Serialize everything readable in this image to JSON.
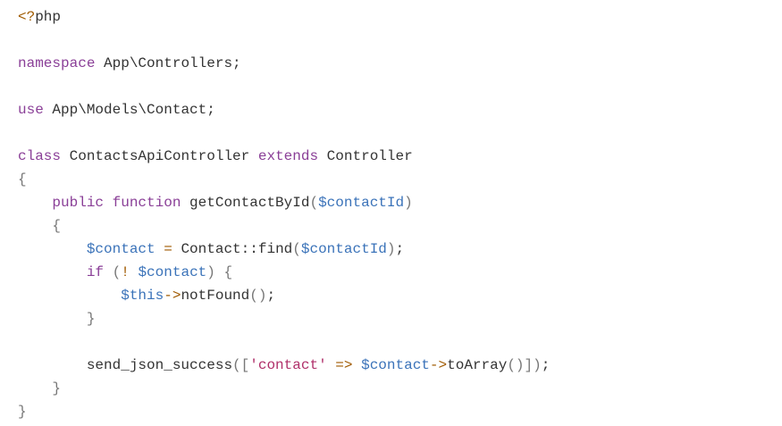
{
  "code": {
    "language": "php",
    "colors": {
      "default": "#333333",
      "keyword": "#8a3f97",
      "variable": "#3b73b9",
      "string": "#b0306a",
      "operator": "#a05a00",
      "punct": "#777777",
      "phptag": "#a05a00"
    },
    "lines": [
      [
        {
          "t": "phptag",
          "v": "<?"
        },
        {
          "t": "default",
          "v": "php"
        }
      ],
      [],
      [
        {
          "t": "keyword",
          "v": "namespace"
        },
        {
          "t": "default",
          "v": " App\\Controllers;"
        }
      ],
      [],
      [
        {
          "t": "keyword",
          "v": "use"
        },
        {
          "t": "default",
          "v": " App\\Models\\Contact;"
        }
      ],
      [],
      [
        {
          "t": "keyword",
          "v": "class"
        },
        {
          "t": "default",
          "v": " ContactsApiController "
        },
        {
          "t": "keyword",
          "v": "extends"
        },
        {
          "t": "default",
          "v": " Controller"
        }
      ],
      [
        {
          "t": "punct",
          "v": "{"
        }
      ],
      [
        {
          "t": "default",
          "v": "    "
        },
        {
          "t": "keyword",
          "v": "public"
        },
        {
          "t": "default",
          "v": " "
        },
        {
          "t": "keyword",
          "v": "function"
        },
        {
          "t": "default",
          "v": " getContactById"
        },
        {
          "t": "punct",
          "v": "("
        },
        {
          "t": "variable",
          "v": "$contactId"
        },
        {
          "t": "punct",
          "v": ")"
        }
      ],
      [
        {
          "t": "default",
          "v": "    "
        },
        {
          "t": "punct",
          "v": "{"
        }
      ],
      [
        {
          "t": "default",
          "v": "        "
        },
        {
          "t": "variable",
          "v": "$contact"
        },
        {
          "t": "default",
          "v": " "
        },
        {
          "t": "operator",
          "v": "="
        },
        {
          "t": "default",
          "v": " Contact::find"
        },
        {
          "t": "punct",
          "v": "("
        },
        {
          "t": "variable",
          "v": "$contactId"
        },
        {
          "t": "punct",
          "v": ")"
        },
        {
          "t": "default",
          "v": ";"
        }
      ],
      [
        {
          "t": "default",
          "v": "        "
        },
        {
          "t": "keyword",
          "v": "if"
        },
        {
          "t": "default",
          "v": " "
        },
        {
          "t": "punct",
          "v": "("
        },
        {
          "t": "operator",
          "v": "!"
        },
        {
          "t": "default",
          "v": " "
        },
        {
          "t": "variable",
          "v": "$contact"
        },
        {
          "t": "punct",
          "v": ")"
        },
        {
          "t": "default",
          "v": " "
        },
        {
          "t": "punct",
          "v": "{"
        }
      ],
      [
        {
          "t": "default",
          "v": "            "
        },
        {
          "t": "variable",
          "v": "$this"
        },
        {
          "t": "operator",
          "v": "->"
        },
        {
          "t": "default",
          "v": "notFound"
        },
        {
          "t": "punct",
          "v": "()"
        },
        {
          "t": "default",
          "v": ";"
        }
      ],
      [
        {
          "t": "default",
          "v": "        "
        },
        {
          "t": "punct",
          "v": "}"
        }
      ],
      [],
      [
        {
          "t": "default",
          "v": "        send_json_success"
        },
        {
          "t": "punct",
          "v": "(["
        },
        {
          "t": "string",
          "v": "'contact'"
        },
        {
          "t": "default",
          "v": " "
        },
        {
          "t": "operator",
          "v": "=>"
        },
        {
          "t": "default",
          "v": " "
        },
        {
          "t": "variable",
          "v": "$contact"
        },
        {
          "t": "operator",
          "v": "->"
        },
        {
          "t": "default",
          "v": "toArray"
        },
        {
          "t": "punct",
          "v": "()])"
        },
        {
          "t": "default",
          "v": ";"
        }
      ],
      [
        {
          "t": "default",
          "v": "    "
        },
        {
          "t": "punct",
          "v": "}"
        }
      ],
      [
        {
          "t": "punct",
          "v": "}"
        }
      ]
    ]
  }
}
